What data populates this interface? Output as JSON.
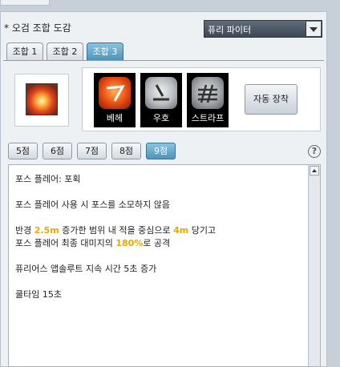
{
  "title": "* 오검 조합 도감",
  "dropdown": {
    "selected": "퓨리 파이터"
  },
  "tabs": [
    {
      "label": "조합 1"
    },
    {
      "label": "조합 2"
    },
    {
      "label": "조합 3"
    }
  ],
  "combo_skills": [
    {
      "label": "베헤",
      "icon": "beheh-icon"
    },
    {
      "label": "우호",
      "icon": "uho-icon"
    },
    {
      "label": "스트라프",
      "icon": "strafe-icon"
    }
  ],
  "auto_equip_label": "자동 장착",
  "points": [
    "5점",
    "6점",
    "7점",
    "8점",
    "9점"
  ],
  "selected_point": "9점",
  "help_label": "?",
  "description": {
    "line1": "포스 플레어: 포획",
    "line2": "포스 플레어 사용 시 포스를 소모하지 않음",
    "line3a": "반경 ",
    "line3b": "2.5m",
    "line3c": " 증가한 범위 내 적을 중심으로 ",
    "line3d": "4m",
    "line3e": " 당기고",
    "line4a": "포스 플레어 최종 대미지의 ",
    "line4b": "180%",
    "line4c": "로 공격",
    "line5": "퓨리어스 앱솔루트 지속 시간 5초 증가",
    "line6": "쿨타임 15초"
  }
}
